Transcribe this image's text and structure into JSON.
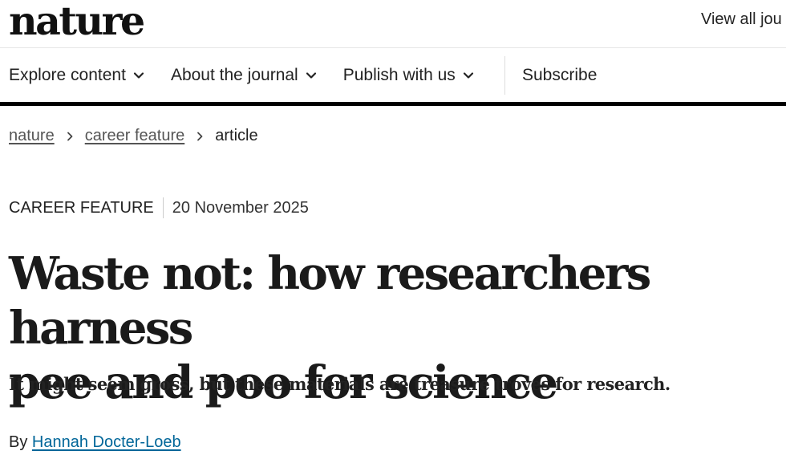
{
  "header": {
    "logo_text": "nature",
    "view_all_text": "View all jou"
  },
  "nav": {
    "items": [
      {
        "label": "Explore content",
        "has_dropdown": true,
        "icon": "chevron-down-icon"
      },
      {
        "label": "About the journal",
        "has_dropdown": true,
        "icon": "chevron-down-icon"
      },
      {
        "label": "Publish with us",
        "has_dropdown": true,
        "icon": "chevron-down-icon"
      }
    ],
    "subscribe_label": "Subscribe"
  },
  "breadcrumb": {
    "items": [
      {
        "label": "nature",
        "link": true
      },
      {
        "label": "career feature",
        "link": true
      },
      {
        "label": "article",
        "link": false
      }
    ],
    "separator_icon": "chevron-right-icon"
  },
  "article": {
    "type": "CAREER FEATURE",
    "date": "20 November 2025",
    "title_line1": "Waste not: how researchers harness",
    "title_line2": "pee and poo for science",
    "standfirst": "It might seem gross, but these materials are treasure troves for research.",
    "byline_prefix": "By",
    "author": "Hannah Docter-Loeb"
  },
  "colors": {
    "text": "#222222",
    "author_link": "#006699",
    "breadcrumb_link": "#555555",
    "nav_rule": "#000000"
  }
}
